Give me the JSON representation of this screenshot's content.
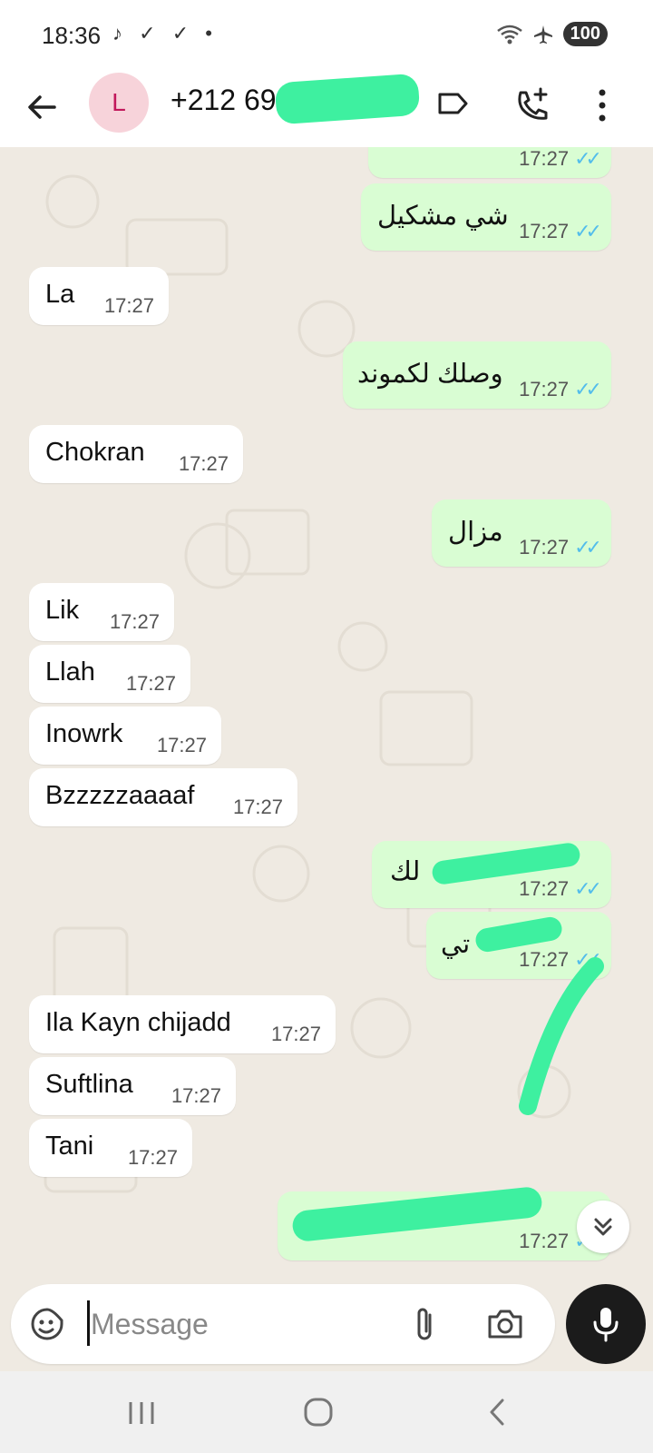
{
  "status_bar": {
    "time": "18:36",
    "battery": "100"
  },
  "header": {
    "avatar_letter": "L",
    "contact": "+212 69"
  },
  "messages": [
    {
      "text": "",
      "time": "17:27"
    },
    {
      "text": "شي مشكيل",
      "time": "17:27"
    },
    {
      "text": "La",
      "time": "17:27"
    },
    {
      "text": "وصلك لكموند",
      "time": "17:27"
    },
    {
      "text": "Chokran",
      "time": "17:27"
    },
    {
      "text": "مزال",
      "time": "17:27"
    },
    {
      "text": "Lik",
      "time": "17:27"
    },
    {
      "text": "Llah",
      "time": "17:27"
    },
    {
      "text": "Inowrk",
      "time": "17:27"
    },
    {
      "text": "Bzzzzzaaaaf",
      "time": "17:27"
    },
    {
      "text": "لك",
      "time": "17:27"
    },
    {
      "text": "تي",
      "time": "17:27"
    },
    {
      "text": "Ila Kayn chijadd",
      "time": "17:27"
    },
    {
      "text": "Suftlina",
      "time": "17:27"
    },
    {
      "text": "Tani",
      "time": "17:27"
    },
    {
      "text": "",
      "time": "17:27"
    }
  ],
  "composer": {
    "placeholder": "Message"
  },
  "colors": {
    "incoming": "#ffffff",
    "outgoing": "#d9fdd3",
    "read_ticks": "#53bdeb",
    "background": "#efeae2",
    "redaction": "#3ef0a0"
  }
}
